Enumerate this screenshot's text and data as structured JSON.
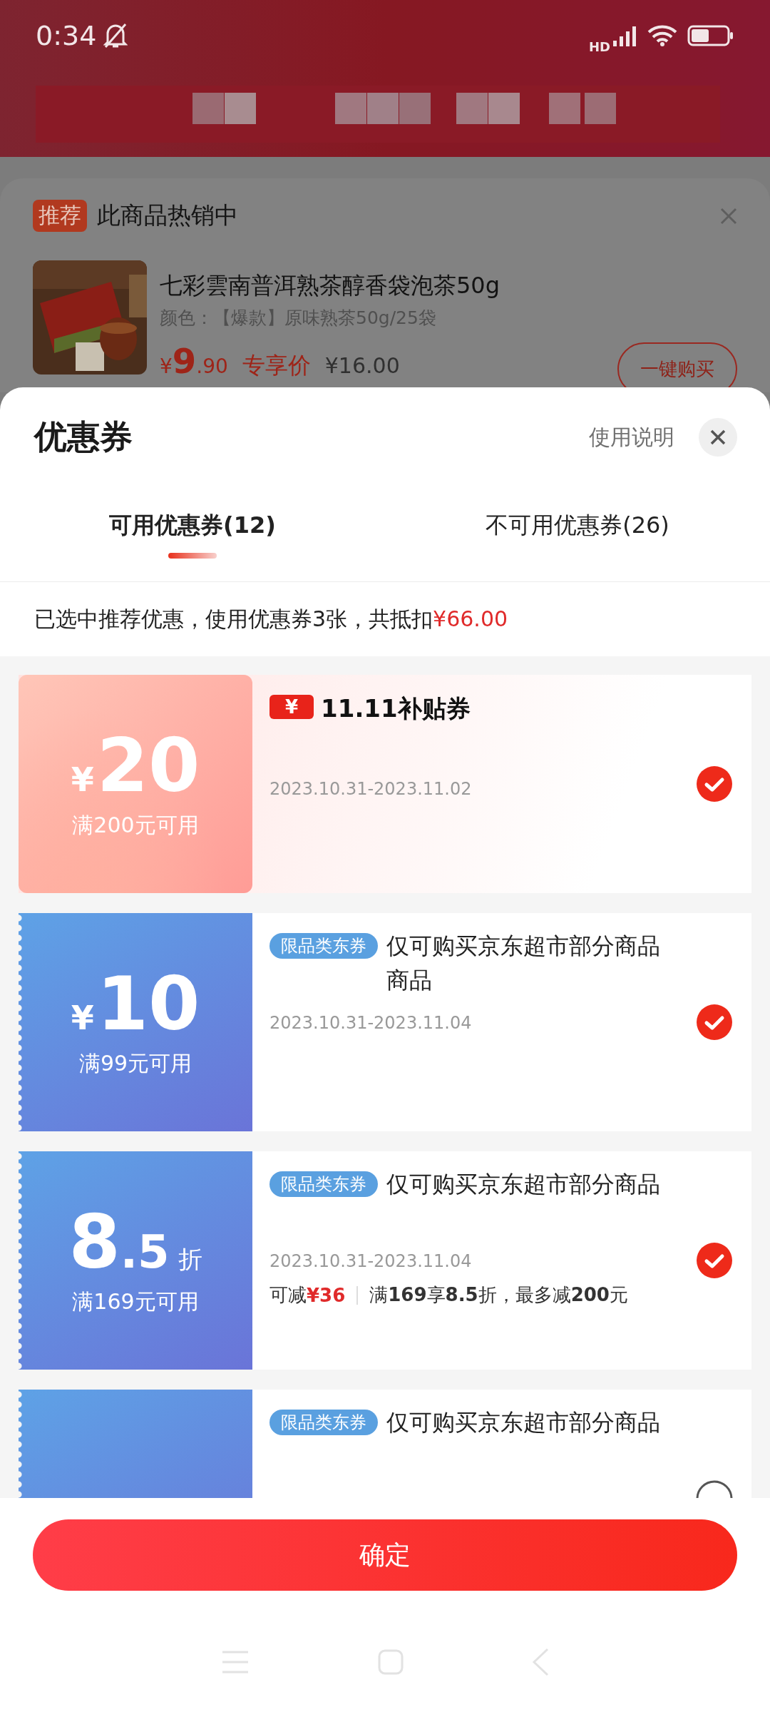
{
  "status_bar": {
    "time": "0:34",
    "network": "HD"
  },
  "background": {
    "recommend": {
      "tag": "推荐",
      "title": "此商品热销中"
    },
    "product": {
      "title": "七彩雲南普洱熟茶醇香袋泡茶50g",
      "variant": "颜色：【爆款】原味熟茶50g/25袋",
      "currency": "¥",
      "price_int": "9",
      "price_dec": ".90",
      "price_label": "专享价",
      "original_price": "¥16.00",
      "buy_button": "一键购买"
    }
  },
  "sheet": {
    "title": "优惠券",
    "help": "使用说明",
    "tabs": [
      {
        "label": "可用优惠券(12)",
        "selected": true
      },
      {
        "label": "不可用优惠券(26)",
        "selected": false
      }
    ],
    "summary": {
      "text": "已选中推荐优惠，使用优惠券3张，共抵扣",
      "amount": "¥66.00"
    },
    "coupons": [
      {
        "kind": "subsidy",
        "currency": "¥",
        "amount": "20",
        "condition": "满200元可用",
        "logo_mark": "¥",
        "title": "11.11补贴券",
        "date": "2023.10.31-2023.11.02",
        "selected": true
      },
      {
        "kind": "category",
        "currency": "¥",
        "amount": "10",
        "condition": "满99元可用",
        "tag": "限品类东券",
        "title": "仅可购买京东超市部分商品商品",
        "date": "2023.10.31-2023.11.04",
        "selected": true
      },
      {
        "kind": "category",
        "amount": "8",
        "amount_small": ".5",
        "unit": "折",
        "condition": "满169元可用",
        "tag": "限品类东券",
        "title": "仅可购买京东超市部分商品",
        "date": "2023.10.31-2023.11.04",
        "saving_label": "可减",
        "saving_amount": "¥36",
        "detail": "满**169**享**8.5**折，最多减**200**元",
        "selected": true
      },
      {
        "kind": "category",
        "tag": "限品类东券",
        "title": "仅可购买京东超市部分商品",
        "selected": false
      }
    ],
    "confirm": "确定"
  }
}
